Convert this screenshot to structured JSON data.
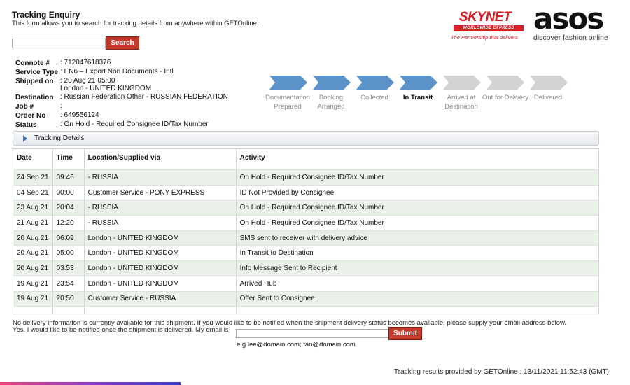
{
  "header": {
    "title": "Tracking Enquiry",
    "subtitle": "This form allows you to search for tracking details from anywhere within GETOnline."
  },
  "search": {
    "value": "",
    "placeholder": "",
    "button_label": "Search"
  },
  "logos": {
    "skynet": {
      "word": "SKYNET",
      "band": "WORLDWIDE EXPRESS",
      "tagline": "The Partnership that delivers"
    },
    "asos": {
      "word": "asos",
      "tagline": "discover fashion online"
    }
  },
  "shipment": {
    "connote": {
      "label": "Connote #",
      "value": ": 712047618376"
    },
    "service_type": {
      "label": "Service Type",
      "value": ": EN6 – Export Non Documents - Intl"
    },
    "shipped_on": {
      "label": "Shipped on",
      "value": ": 20 Aug 21 05:00",
      "value2": "London - UNITED KINGDOM"
    },
    "destination": {
      "label": "Destination",
      "value": ": Russian Federation Other - RUSSIAN FEDERATION"
    },
    "job": {
      "label": "Job #",
      "value": ":"
    },
    "order_no": {
      "label": "Order No",
      "value": ": 649556124"
    },
    "status": {
      "label": "Status",
      "value": ": On Hold - Required Consignee ID/Tax Number"
    }
  },
  "progress": {
    "active_color": "#5b93c9",
    "inactive_color": "#d3d3d3",
    "current_step": 4,
    "steps": [
      {
        "label1": "Documentation",
        "label2": "Prepared"
      },
      {
        "label1": "Booking",
        "label2": "Arranged"
      },
      {
        "label1": "Collected",
        "label2": ""
      },
      {
        "label1": "In Transit",
        "label2": ""
      },
      {
        "label1": "Arrived at",
        "label2": "Destination"
      },
      {
        "label1": "Out for Delivery",
        "label2": ""
      },
      {
        "label1": "Delivered",
        "label2": ""
      }
    ]
  },
  "tracking": {
    "section_label": "Tracking Details",
    "columns": [
      "Date",
      "Time",
      "Location/Supplied via",
      "Activity"
    ],
    "rows": [
      {
        "date": "24 Sep 21",
        "time": "09:46",
        "location": "- RUSSIA",
        "activity": "On Hold - Required Consignee ID/Tax Number"
      },
      {
        "date": "04 Sep 21",
        "time": "00:00",
        "location": "Customer Service - PONY EXPRESS",
        "activity": "ID Not Provided by Consignee"
      },
      {
        "date": "23 Aug 21",
        "time": "20:04",
        "location": "- RUSSIA",
        "activity": "On Hold - Required Consignee ID/Tax Number"
      },
      {
        "date": "21 Aug 21",
        "time": "12:20",
        "location": "- RUSSIA",
        "activity": "On Hold - Required Consignee ID/Tax Number"
      },
      {
        "date": "20 Aug 21",
        "time": "06:09",
        "location": "London - UNITED KINGDOM",
        "activity": "SMS sent to receiver with delivery advice"
      },
      {
        "date": "20 Aug 21",
        "time": "05:00",
        "location": "London - UNITED KINGDOM",
        "activity": "In Transit to Destination"
      },
      {
        "date": "20 Aug 21",
        "time": "03:53",
        "location": "London - UNITED KINGDOM",
        "activity": "Info Message Sent to Recipient"
      },
      {
        "date": "19 Aug 21",
        "time": "23:54",
        "location": "London - UNITED KINGDOM",
        "activity": "Arrived Hub"
      },
      {
        "date": "19 Aug 21",
        "time": "20:50",
        "location": "Customer Service - RUSSIA",
        "activity": "Offer Sent to Consignee"
      }
    ]
  },
  "notify": {
    "line1": "No delivery information is currently available for this shipment. If you would like to be notified when the shipment delivery status becomes available, please supply your email address below.",
    "line2": "Yes. I would like to be notified once the shipment is delivered. My email is",
    "email_value": "",
    "submit_label": "Submit",
    "example": "e.g lee@domain.com; tan@domain.com"
  },
  "footer": {
    "text": "Tracking results provided by GETOnline : 13/11/2021 11:52:43 (GMT)"
  }
}
